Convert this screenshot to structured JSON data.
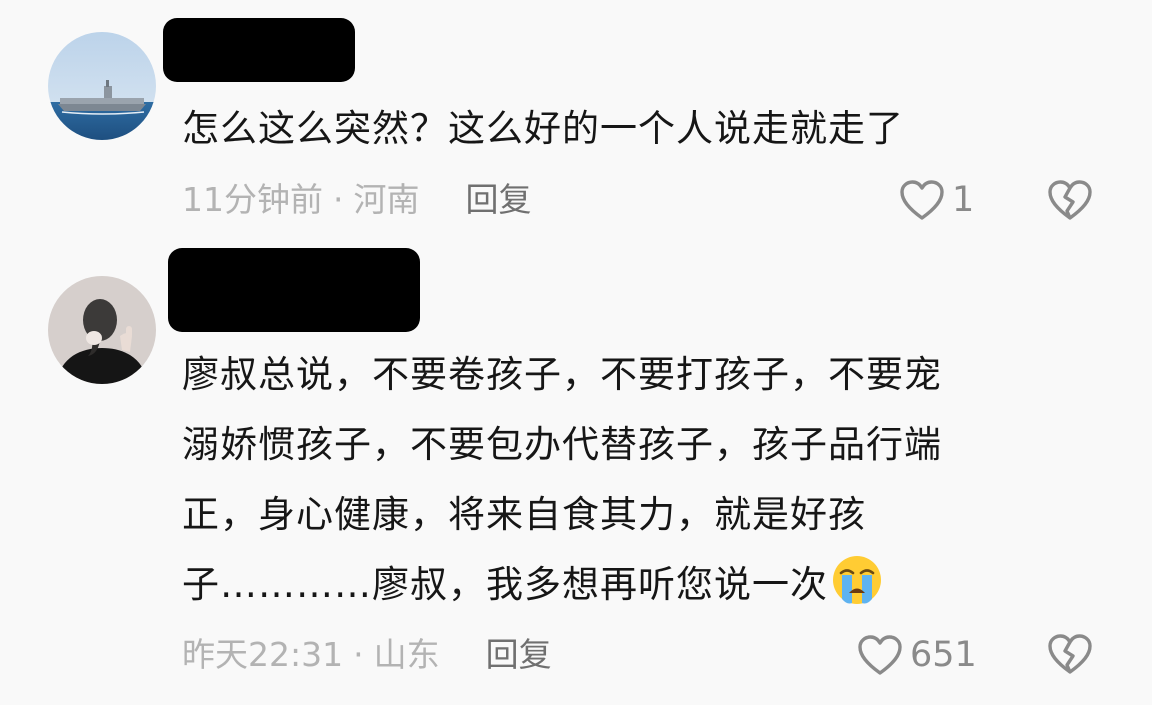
{
  "comments": [
    {
      "text": "怎么这么突然？这么好的一个人说走就走了",
      "time": "11分钟前",
      "location": "河南",
      "separator": "·",
      "reply_label": "回复",
      "likes": "1",
      "avatar_icon": "aircraft-carrier-photo-avatar",
      "username_redacted": true
    },
    {
      "text_lines": [
        "廖叔总说，不要卷孩子，不要打孩子，不要宠",
        "溺娇惯孩子，不要包办代替孩子，孩子品行端",
        "正，身心健康，将来自食其力，就是好孩",
        "子…………廖叔，我多想再听您说一次"
      ],
      "emoji": "loudly-crying-face-emoji",
      "time": "昨天22:31",
      "location": "山东",
      "separator": "·",
      "reply_label": "回复",
      "likes": "651",
      "avatar_icon": "woman-back-photo-avatar",
      "username_redacted": true
    }
  ],
  "colors": {
    "background": "#f9f9f9",
    "text": "#161616",
    "meta": "#b3b3b3",
    "reply": "#707070",
    "icon": "#8a8a8a",
    "redaction": "#000000"
  },
  "icons": {
    "like": "heart-outline-icon",
    "dislike": "broken-heart-outline-icon"
  }
}
